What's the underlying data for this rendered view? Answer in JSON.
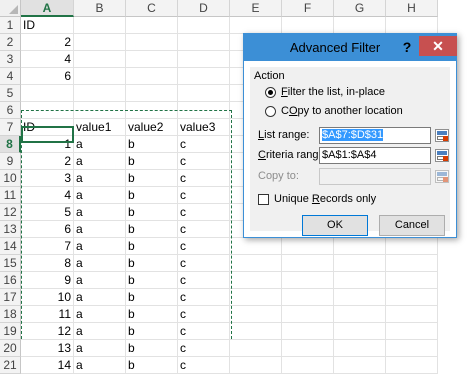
{
  "sheet": {
    "columns": [
      "A",
      "B",
      "C",
      "D",
      "E",
      "F",
      "G",
      "H"
    ],
    "rows": [
      "1",
      "2",
      "3",
      "4",
      "5",
      "6",
      "7",
      "8",
      "9",
      "10",
      "11",
      "12",
      "13",
      "14",
      "15",
      "16",
      "17",
      "18",
      "19",
      "20",
      "21"
    ],
    "active_column": "A",
    "active_row": "8",
    "cells": [
      [
        "ID",
        "",
        "",
        "",
        "",
        "",
        "",
        ""
      ],
      [
        "2",
        "",
        "",
        "",
        "",
        "",
        "",
        ""
      ],
      [
        "4",
        "",
        "",
        "",
        "",
        "",
        "",
        ""
      ],
      [
        "6",
        "",
        "",
        "",
        "",
        "",
        "",
        ""
      ],
      [
        "",
        "",
        "",
        "",
        "",
        "",
        "",
        ""
      ],
      [
        "",
        "",
        "",
        "",
        "",
        "",
        "",
        ""
      ],
      [
        "ID",
        "value1",
        "value2",
        "value3",
        "",
        "",
        "",
        ""
      ],
      [
        "1",
        "a",
        "b",
        "c",
        "",
        "",
        "",
        ""
      ],
      [
        "2",
        "a",
        "b",
        "c",
        "",
        "",
        "",
        ""
      ],
      [
        "3",
        "a",
        "b",
        "c",
        "",
        "",
        "",
        ""
      ],
      [
        "4",
        "a",
        "b",
        "c",
        "",
        "",
        "",
        ""
      ],
      [
        "5",
        "a",
        "b",
        "c",
        "",
        "",
        "",
        ""
      ],
      [
        "6",
        "a",
        "b",
        "c",
        "",
        "",
        "",
        ""
      ],
      [
        "7",
        "a",
        "b",
        "c",
        "",
        "",
        "",
        ""
      ],
      [
        "8",
        "a",
        "b",
        "c",
        "",
        "",
        "",
        ""
      ],
      [
        "9",
        "a",
        "b",
        "c",
        "",
        "",
        "",
        ""
      ],
      [
        "10",
        "a",
        "b",
        "c",
        "",
        "",
        "",
        ""
      ],
      [
        "11",
        "a",
        "b",
        "c",
        "",
        "",
        "",
        ""
      ],
      [
        "12",
        "a",
        "b",
        "c",
        "",
        "",
        "",
        ""
      ],
      [
        "13",
        "a",
        "b",
        "c",
        "",
        "",
        "",
        ""
      ],
      [
        "14",
        "a",
        "b",
        "c",
        "",
        "",
        "",
        ""
      ]
    ]
  },
  "dialog": {
    "title": "Advanced Filter",
    "help": "?",
    "close": "✕",
    "action_label": "Action",
    "radio_filter_prefix": "F",
    "radio_filter_rest": "ilter the list, in-place",
    "radio_copy_prefix": "",
    "radio_copy_ul": "O",
    "radio_copy_rest": " to another location",
    "list_range_ul": "L",
    "list_range_rest": "ist range:",
    "list_range_value": "$A$7:$D$31",
    "criteria_range_ul": "C",
    "criteria_range_rest": "riteria range:",
    "criteria_range_value": "$A$1:$A$4",
    "copy_to_label": "Copy to:",
    "copy_to_value": "",
    "unique_ul": "R",
    "unique_pre": "Unique ",
    "unique_rest": "ecords only",
    "ok_label": "OK",
    "cancel_label": "Cancel"
  },
  "colors": {
    "accent": "#217346",
    "title_bar": "#3c8fd6",
    "close_button": "#c75050",
    "selection": "#3399ff"
  }
}
